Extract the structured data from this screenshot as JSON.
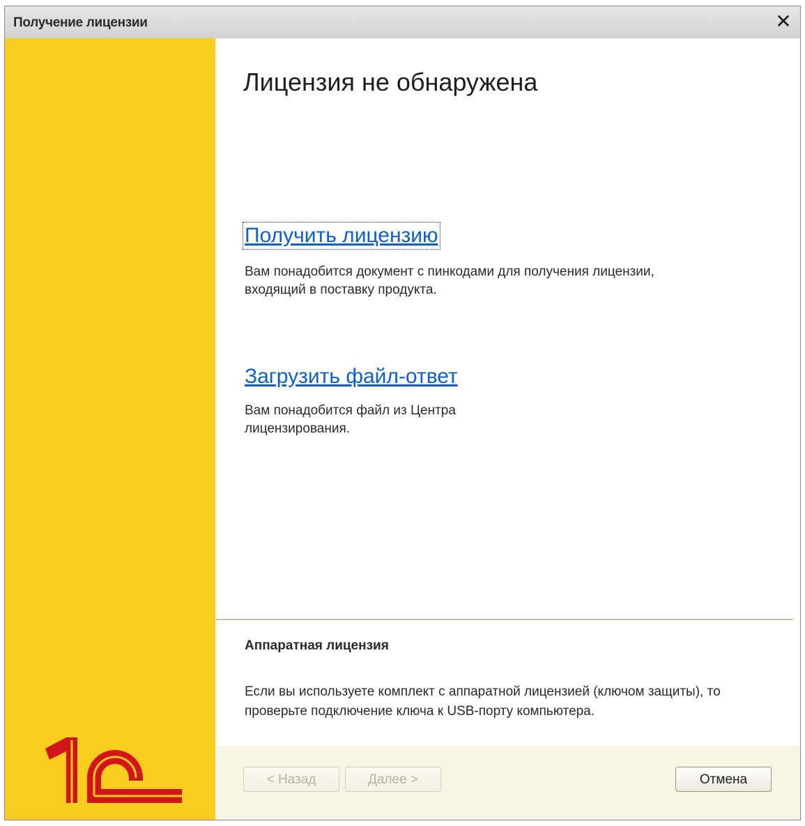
{
  "window": {
    "title": "Получение лицензии",
    "close_glyph": "✕"
  },
  "main": {
    "heading": "Лицензия не обнаружена",
    "option_get": {
      "link": "Получить лицензию",
      "description": "Вам понадобится документ с пинкодами для получения лицензии, входящий в поставку продукта."
    },
    "option_load": {
      "link": "Загрузить файл-ответ",
      "description": "Вам понадобится файл из Центра лицензирования."
    },
    "hardware": {
      "title": "Аппаратная лицензия",
      "description": "Если вы используете комплект с аппаратной лицензией (ключом защиты), то проверьте подключение ключа к USB-порту компьютера."
    }
  },
  "footer": {
    "back_label": "< Назад",
    "next_label": "Далее >",
    "cancel_label": "Отмена"
  },
  "branding": {
    "logo_text": "1С",
    "sidebar_color": "#f8cd1d",
    "logo_color": "#d3141b",
    "link_color": "#0b5fd6"
  }
}
